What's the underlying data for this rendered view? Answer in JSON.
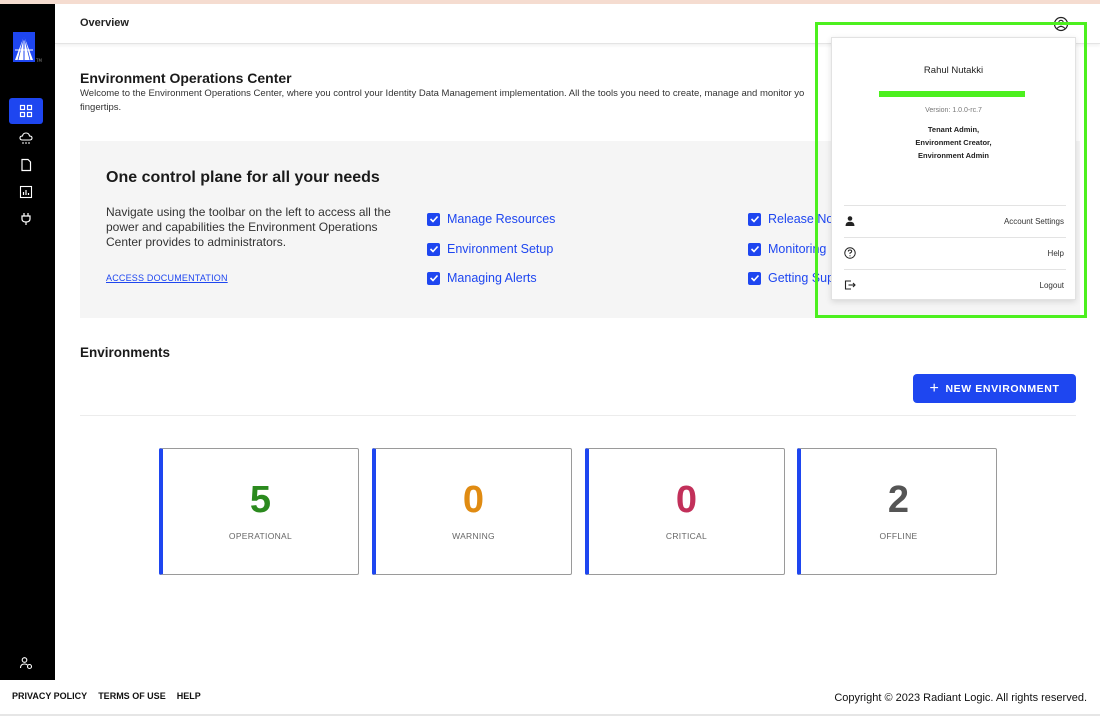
{
  "header": {
    "title": "Overview"
  },
  "sidebar": {
    "items": [
      {
        "name": "dashboard",
        "icon": "dashboard-icon",
        "active": true
      },
      {
        "name": "environments",
        "icon": "cloud-icon",
        "active": false
      },
      {
        "name": "documents",
        "icon": "document-icon",
        "active": false
      },
      {
        "name": "reports",
        "icon": "chart-icon",
        "active": false
      },
      {
        "name": "connectors",
        "icon": "plug-icon",
        "active": false
      }
    ],
    "bottom_icon": "admin-settings-icon"
  },
  "page": {
    "title": "Environment Operations Center",
    "description": "Welcome to the Environment Operations Center, where you control your Identity Data Management implementation. All the tools you need to create, manage and monitor yo",
    "description_end": "fingertips."
  },
  "banner": {
    "title": "One control plane for all your needs",
    "text": "Navigate using the toolbar on the left to access all the power and capabilities the Environment Operations Center provides to administrators.",
    "doc_link": "ACCESS DOCUMENTATION",
    "links": [
      "Manage Resources",
      "Environment Setup",
      "Managing Alerts",
      "Release No",
      "Monitoring I",
      "Getting Sup"
    ]
  },
  "environments": {
    "title": "Environments",
    "new_button": "NEW ENVIRONMENT",
    "stats": [
      {
        "value": "5",
        "label": "OPERATIONAL",
        "color": "#2b8a1e"
      },
      {
        "value": "0",
        "label": "WARNING",
        "color": "#e08b12"
      },
      {
        "value": "0",
        "label": "CRITICAL",
        "color": "#c2305a"
      },
      {
        "value": "2",
        "label": "OFFLINE",
        "color": "#555555"
      }
    ]
  },
  "user_menu": {
    "name": "Rahul Nutakki",
    "version": "Version: 1.0.0-rc.7",
    "roles": [
      "Tenant Admin,",
      "Environment Creator,",
      "Environment Admin"
    ],
    "items": [
      {
        "label": "Account Settings",
        "icon": "person-icon"
      },
      {
        "label": "Help",
        "icon": "help-icon"
      },
      {
        "label": "Logout",
        "icon": "logout-icon"
      }
    ]
  },
  "footer": {
    "links": [
      "PRIVACY POLICY",
      "TERMS OF USE",
      "HELP"
    ],
    "copyright": "Copyright © 2023 Radiant Logic. All rights reserved."
  },
  "colors": {
    "accent": "#1e46f0",
    "highlight": "#4cf01e",
    "sidebar": "#000000"
  }
}
